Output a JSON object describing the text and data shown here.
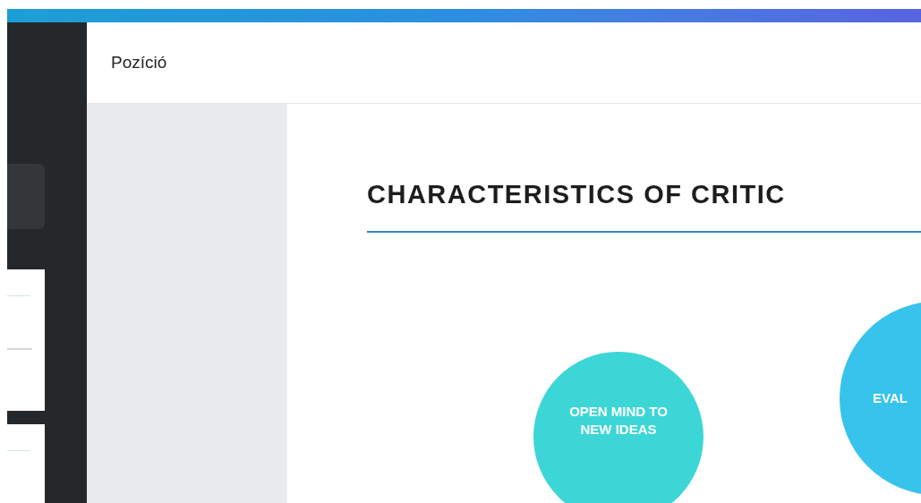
{
  "header": {
    "title": "Pozíció"
  },
  "slide": {
    "title": "CHARACTERISTICS OF CRITIC",
    "circles": [
      {
        "text": "OPEN MIND TO NEW IDEAS",
        "color": "#3dd6d6"
      },
      {
        "text": "EVAL",
        "color": "#38c3ec"
      }
    ]
  }
}
